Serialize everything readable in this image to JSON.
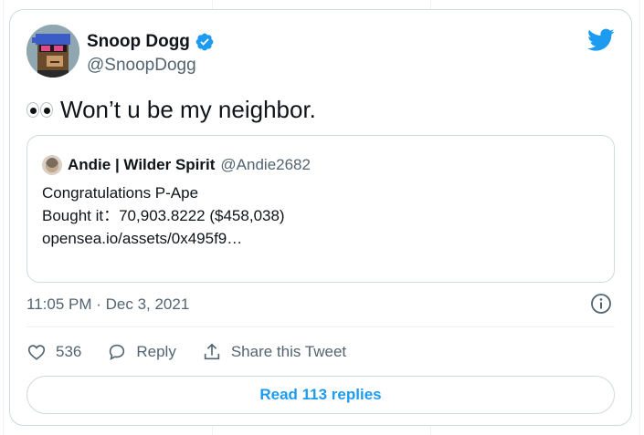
{
  "author": {
    "name": "Snoop Dogg",
    "handle": "@SnoopDogg"
  },
  "tweet": {
    "text": "Won’t u be my neighbor."
  },
  "quoted_tweet": {
    "name": "Andie | Wilder Spirit",
    "handle": "@Andie2682",
    "lines": [
      "Congratulations P-Ape",
      "Bought it：70,903.8222 ($458,038)",
      "",
      "opensea.io/assets/0x495f9…"
    ]
  },
  "timestamp": "11:05 PM · Dec 3, 2021",
  "actions": {
    "like_count": "536",
    "reply_label": "Reply",
    "share_label": "Share this Tweet"
  },
  "read_replies_label": "Read 113 replies",
  "colors": {
    "accent": "#1d9bf0",
    "secondary_text": "#536471",
    "border": "#cfd9de",
    "like": "#536471"
  },
  "icons": [
    "verified-badge-icon",
    "twitter-bird-icon",
    "info-icon",
    "heart-icon",
    "reply-icon",
    "share-icon",
    "eyes-emoji-icon"
  ]
}
